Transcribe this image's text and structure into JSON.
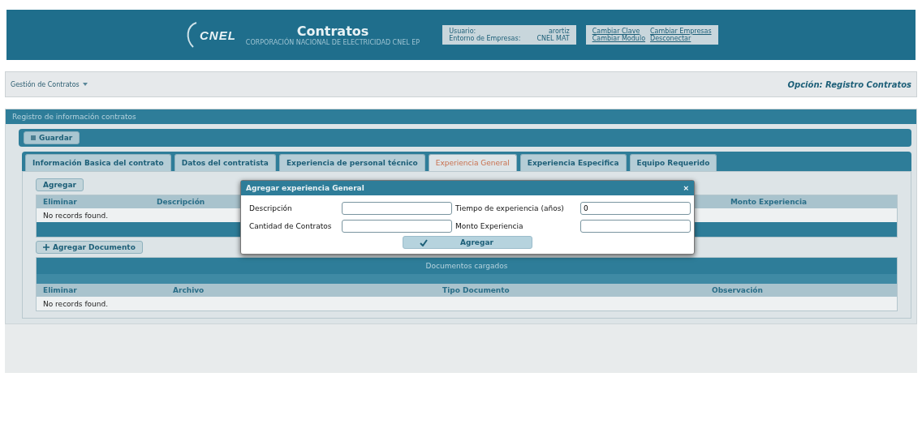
{
  "header": {
    "logo": "CNEL",
    "title": "Contratos",
    "subtitle": "CORPORACIÓN NACIONAL DE ELECTRICIDAD CNEL EP",
    "user_info": [
      {
        "label": "Usuario:",
        "value": "arortiz"
      },
      {
        "label": "Entorno de Empresas:",
        "value": "CNEL MAT"
      }
    ],
    "links": [
      "Cambiar Clave",
      "Cambiar Empresas",
      "Cambiar Modulo",
      "Desconectar"
    ]
  },
  "menu": {
    "item": "Gestión de Contratos",
    "option": "Opción: Registro Contratos"
  },
  "panel": {
    "title": "Registro de información contratos",
    "save_button": "Guardar",
    "tabs": [
      {
        "label": "Información Basica del contrato",
        "selected": false
      },
      {
        "label": "Datos del contratista",
        "selected": false
      },
      {
        "label": "Experiencia de personal técnico",
        "selected": false
      },
      {
        "label": "Experiencia General",
        "selected": true
      },
      {
        "label": "Experiencia Especifica",
        "selected": false
      },
      {
        "label": "Equipo Requerido",
        "selected": false
      }
    ],
    "add_button": "Agregar",
    "table": {
      "columns": [
        "Eliminar",
        "Descripción",
        "Monto Experiencia"
      ],
      "empty": "No records found."
    },
    "add_document_button": "Agregar Documento",
    "documents": {
      "title": "Documentos cargados",
      "columns": [
        "Eliminar",
        "Archivo",
        "Tipo Documento",
        "Observación"
      ],
      "empty": "No records found."
    }
  },
  "dialog": {
    "title": "Agregar experiencia General",
    "close": "×",
    "fields": [
      {
        "label": "Descripción"
      },
      {
        "label": "Tiempo de experiencia (años)",
        "value": "0"
      },
      {
        "label": "Cantidad de Contratos"
      },
      {
        "label": "Monto Experiencia"
      }
    ],
    "button": "Agregar"
  }
}
